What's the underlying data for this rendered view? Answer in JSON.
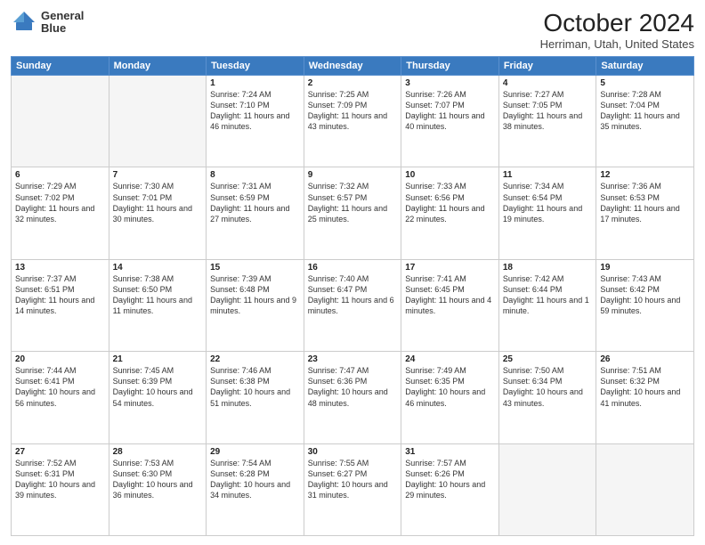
{
  "header": {
    "logo_line1": "General",
    "logo_line2": "Blue",
    "title": "October 2024",
    "subtitle": "Herriman, Utah, United States"
  },
  "columns": [
    "Sunday",
    "Monday",
    "Tuesday",
    "Wednesday",
    "Thursday",
    "Friday",
    "Saturday"
  ],
  "weeks": [
    [
      {
        "day": "",
        "info": ""
      },
      {
        "day": "",
        "info": ""
      },
      {
        "day": "1",
        "info": "Sunrise: 7:24 AM\nSunset: 7:10 PM\nDaylight: 11 hours and 46 minutes."
      },
      {
        "day": "2",
        "info": "Sunrise: 7:25 AM\nSunset: 7:09 PM\nDaylight: 11 hours and 43 minutes."
      },
      {
        "day": "3",
        "info": "Sunrise: 7:26 AM\nSunset: 7:07 PM\nDaylight: 11 hours and 40 minutes."
      },
      {
        "day": "4",
        "info": "Sunrise: 7:27 AM\nSunset: 7:05 PM\nDaylight: 11 hours and 38 minutes."
      },
      {
        "day": "5",
        "info": "Sunrise: 7:28 AM\nSunset: 7:04 PM\nDaylight: 11 hours and 35 minutes."
      }
    ],
    [
      {
        "day": "6",
        "info": "Sunrise: 7:29 AM\nSunset: 7:02 PM\nDaylight: 11 hours and 32 minutes."
      },
      {
        "day": "7",
        "info": "Sunrise: 7:30 AM\nSunset: 7:01 PM\nDaylight: 11 hours and 30 minutes."
      },
      {
        "day": "8",
        "info": "Sunrise: 7:31 AM\nSunset: 6:59 PM\nDaylight: 11 hours and 27 minutes."
      },
      {
        "day": "9",
        "info": "Sunrise: 7:32 AM\nSunset: 6:57 PM\nDaylight: 11 hours and 25 minutes."
      },
      {
        "day": "10",
        "info": "Sunrise: 7:33 AM\nSunset: 6:56 PM\nDaylight: 11 hours and 22 minutes."
      },
      {
        "day": "11",
        "info": "Sunrise: 7:34 AM\nSunset: 6:54 PM\nDaylight: 11 hours and 19 minutes."
      },
      {
        "day": "12",
        "info": "Sunrise: 7:36 AM\nSunset: 6:53 PM\nDaylight: 11 hours and 17 minutes."
      }
    ],
    [
      {
        "day": "13",
        "info": "Sunrise: 7:37 AM\nSunset: 6:51 PM\nDaylight: 11 hours and 14 minutes."
      },
      {
        "day": "14",
        "info": "Sunrise: 7:38 AM\nSunset: 6:50 PM\nDaylight: 11 hours and 11 minutes."
      },
      {
        "day": "15",
        "info": "Sunrise: 7:39 AM\nSunset: 6:48 PM\nDaylight: 11 hours and 9 minutes."
      },
      {
        "day": "16",
        "info": "Sunrise: 7:40 AM\nSunset: 6:47 PM\nDaylight: 11 hours and 6 minutes."
      },
      {
        "day": "17",
        "info": "Sunrise: 7:41 AM\nSunset: 6:45 PM\nDaylight: 11 hours and 4 minutes."
      },
      {
        "day": "18",
        "info": "Sunrise: 7:42 AM\nSunset: 6:44 PM\nDaylight: 11 hours and 1 minute."
      },
      {
        "day": "19",
        "info": "Sunrise: 7:43 AM\nSunset: 6:42 PM\nDaylight: 10 hours and 59 minutes."
      }
    ],
    [
      {
        "day": "20",
        "info": "Sunrise: 7:44 AM\nSunset: 6:41 PM\nDaylight: 10 hours and 56 minutes."
      },
      {
        "day": "21",
        "info": "Sunrise: 7:45 AM\nSunset: 6:39 PM\nDaylight: 10 hours and 54 minutes."
      },
      {
        "day": "22",
        "info": "Sunrise: 7:46 AM\nSunset: 6:38 PM\nDaylight: 10 hours and 51 minutes."
      },
      {
        "day": "23",
        "info": "Sunrise: 7:47 AM\nSunset: 6:36 PM\nDaylight: 10 hours and 48 minutes."
      },
      {
        "day": "24",
        "info": "Sunrise: 7:49 AM\nSunset: 6:35 PM\nDaylight: 10 hours and 46 minutes."
      },
      {
        "day": "25",
        "info": "Sunrise: 7:50 AM\nSunset: 6:34 PM\nDaylight: 10 hours and 43 minutes."
      },
      {
        "day": "26",
        "info": "Sunrise: 7:51 AM\nSunset: 6:32 PM\nDaylight: 10 hours and 41 minutes."
      }
    ],
    [
      {
        "day": "27",
        "info": "Sunrise: 7:52 AM\nSunset: 6:31 PM\nDaylight: 10 hours and 39 minutes."
      },
      {
        "day": "28",
        "info": "Sunrise: 7:53 AM\nSunset: 6:30 PM\nDaylight: 10 hours and 36 minutes."
      },
      {
        "day": "29",
        "info": "Sunrise: 7:54 AM\nSunset: 6:28 PM\nDaylight: 10 hours and 34 minutes."
      },
      {
        "day": "30",
        "info": "Sunrise: 7:55 AM\nSunset: 6:27 PM\nDaylight: 10 hours and 31 minutes."
      },
      {
        "day": "31",
        "info": "Sunrise: 7:57 AM\nSunset: 6:26 PM\nDaylight: 10 hours and 29 minutes."
      },
      {
        "day": "",
        "info": ""
      },
      {
        "day": "",
        "info": ""
      }
    ]
  ]
}
